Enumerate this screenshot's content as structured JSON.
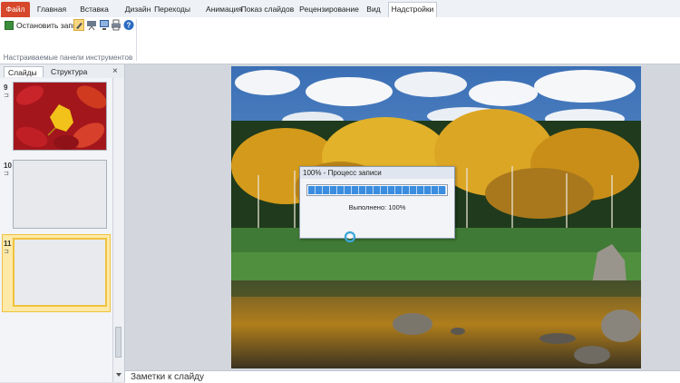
{
  "ribbon": {
    "tabs": [
      {
        "label": "Файл"
      },
      {
        "label": "Главная"
      },
      {
        "label": "Вставка"
      },
      {
        "label": "Дизайн"
      },
      {
        "label": "Переходы"
      },
      {
        "label": "Анимация"
      },
      {
        "label": "Показ слайдов"
      },
      {
        "label": "Рецензирование"
      },
      {
        "label": "Вид"
      },
      {
        "label": "Надстройки"
      }
    ],
    "active_tab": "Надстройки",
    "stop_record_label": "Остановить запись",
    "group_label": "Настраиваемые панели инструментов",
    "toolbar_icons": [
      "pen-icon",
      "projector-icon",
      "monitor-icon",
      "printer-icon",
      "help-icon"
    ]
  },
  "left_panel": {
    "tabs": [
      {
        "label": "Слайды"
      },
      {
        "label": "Структура"
      }
    ],
    "close_glyph": "×",
    "slides": [
      {
        "number": "9",
        "icon": "⊐"
      },
      {
        "number": "10",
        "icon": "⊐"
      },
      {
        "number": "11",
        "icon": "⊐"
      }
    ],
    "selected_slide": "11"
  },
  "dialog": {
    "title": "100% - Процесс записи",
    "progress": 1.0,
    "status": "Выполнено: 100%"
  },
  "notes": {
    "placeholder": "Заметки к слайду"
  },
  "colors": {
    "file_tab": "#d6472b",
    "selected_thumb_border": "#f0c23d",
    "progress_fill": "#3a8ddf"
  }
}
